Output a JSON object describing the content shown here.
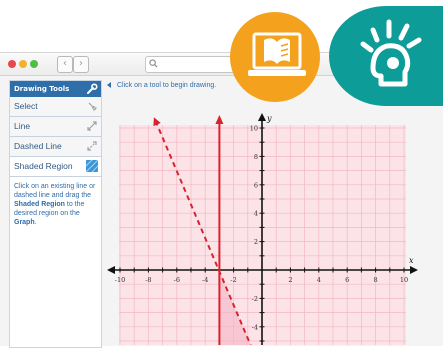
{
  "browser": {
    "back_glyph": "‹",
    "forward_glyph": "›"
  },
  "sidebar": {
    "header": "Drawing Tools",
    "tools": [
      {
        "label": "Select",
        "icon": "hand-pointer-icon"
      },
      {
        "label": "Line",
        "icon": "line-icon"
      },
      {
        "label": "Dashed Line",
        "icon": "dashed-line-icon"
      },
      {
        "label": "Shaded Region",
        "icon": "shaded-region-icon"
      }
    ],
    "help": {
      "part1": "Click on an existing line or dashed line and drag the ",
      "bold1": "Shaded Region",
      "part2": " to the desired region on the ",
      "bold2": "Graph",
      "part3": "."
    }
  },
  "instruction": "Click on a tool to begin drawing.",
  "graph": {
    "x_tick_labels": [
      "-10",
      "-8",
      "-6",
      "-4",
      "-2",
      "2",
      "4",
      "6",
      "8",
      "10"
    ],
    "y_tick_labels": [
      "10",
      "8",
      "6",
      "4",
      "2",
      "-2",
      "-4"
    ],
    "x_axis_label": "x",
    "y_axis_label": "y",
    "solid_line": {
      "x": -3
    },
    "dashed_line": {
      "points": [
        [
          -7.5,
          10.5
        ],
        [
          -0.5,
          -6
        ]
      ]
    },
    "colors": {
      "grid_fill": "#fbe3e8",
      "grid_line": "#f3b8c4",
      "shaded": "#f7c8d4",
      "line": "#d8232e"
    }
  },
  "badges": {
    "book_color": "#f4a21d",
    "idea_color": "#0e9c99"
  }
}
